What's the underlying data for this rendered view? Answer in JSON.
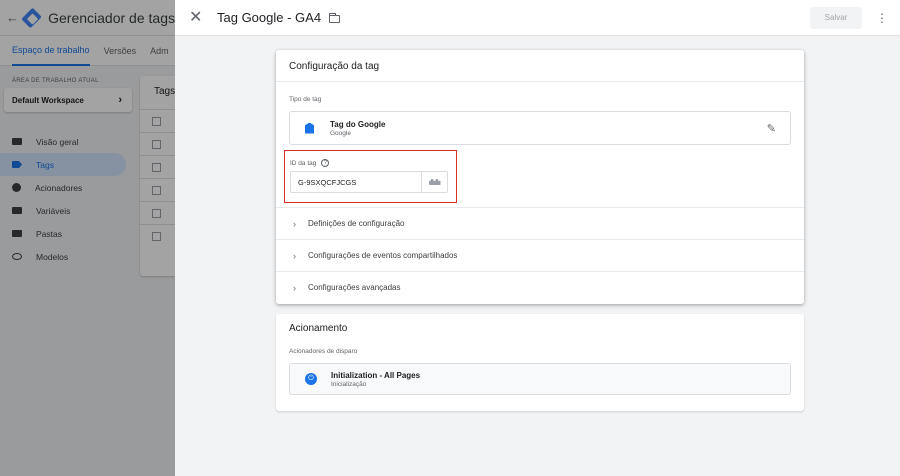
{
  "background": {
    "back_icon": "←",
    "app_title": "Gerenciador de tags",
    "tabs": [
      "Espaço de trabalho",
      "Versões",
      "Adm"
    ],
    "workspace_label": "ÁREA DE TRABALHO ATUAL",
    "workspace_name": "Default Workspace",
    "workspace_chevron": "›",
    "nav": [
      {
        "label": "Visão geral",
        "icon": "overview-icon"
      },
      {
        "label": "Tags",
        "icon": "tag-icon",
        "active": true
      },
      {
        "label": "Acionadores",
        "icon": "trigger-icon"
      },
      {
        "label": "Variáveis",
        "icon": "variables-icon"
      },
      {
        "label": "Pastas",
        "icon": "folder-icon"
      },
      {
        "label": "Modelos",
        "icon": "template-icon"
      }
    ],
    "tags_panel_title": "Tags"
  },
  "editor": {
    "close_icon": "✕",
    "title": "Tag Google - GA4",
    "save_label": "Salvar",
    "more_icon": "⋮",
    "config": {
      "title": "Configuração da tag",
      "tag_type_label": "Tipo de tag",
      "tag_type_name": "Tag do Google",
      "tag_type_vendor": "Google",
      "edit_icon": "✎",
      "tag_id_label": "ID da tag",
      "help_icon": "?",
      "tag_id_value": "G-9SXQCFJCGS",
      "expanders": [
        "Definições de configuração",
        "Configurações de eventos compartilhados",
        "Configurações avançadas"
      ],
      "chevron": "›"
    },
    "triggering": {
      "title": "Acionamento",
      "label": "Acionadores de disparo",
      "trigger_name": "Initialization - All Pages",
      "trigger_type": "Inicialização",
      "power_icon": "⏻"
    }
  },
  "colors": {
    "accent": "#1a73e8",
    "highlight_border": "#d93025"
  }
}
